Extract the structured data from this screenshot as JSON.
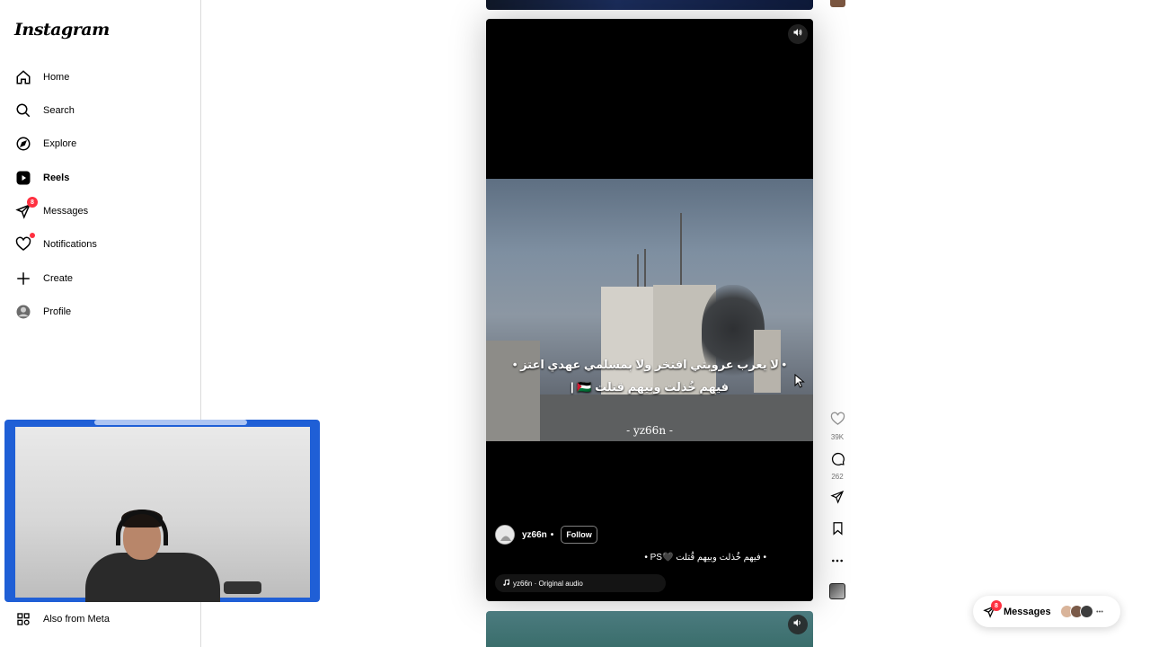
{
  "app": {
    "logo": "Instagram"
  },
  "sidebar": {
    "items": [
      {
        "id": "home",
        "label": "Home",
        "icon": "home-icon"
      },
      {
        "id": "search",
        "label": "Search",
        "icon": "search-icon"
      },
      {
        "id": "explore",
        "label": "Explore",
        "icon": "compass-icon"
      },
      {
        "id": "reels",
        "label": "Reels",
        "icon": "reels-icon",
        "active": true
      },
      {
        "id": "messages",
        "label": "Messages",
        "icon": "messenger-icon",
        "badge": "8"
      },
      {
        "id": "notifications",
        "label": "Notifications",
        "icon": "heart-icon",
        "dot": true
      },
      {
        "id": "create",
        "label": "Create",
        "icon": "plus-icon"
      },
      {
        "id": "profile",
        "label": "Profile",
        "icon": "avatar"
      }
    ],
    "footer": {
      "label": "Also from Meta",
      "icon": "meta-icon"
    }
  },
  "reel": {
    "caption_line1": "• لا يعرب عروبتي افتخر ولا بمسلمي عهدي اعتز •",
    "caption_line2": "فيهم خُذلت وبيهم قتلت 🇵🇸 |",
    "watermark": "- yz66n -",
    "author": "yz66n",
    "separator": "•",
    "follow_label": "Follow",
    "description": "• فيهم خُذلت وبيهم قُتلت 🖤PS •",
    "audio": "yz66n · Original audio"
  },
  "actions": {
    "likes": "39K",
    "comments": "262"
  },
  "messages_pill": {
    "label": "Messages",
    "badge": "8"
  },
  "colors": {
    "accent_red": "#ff3040",
    "webcam_frame": "#1f5fd6"
  }
}
